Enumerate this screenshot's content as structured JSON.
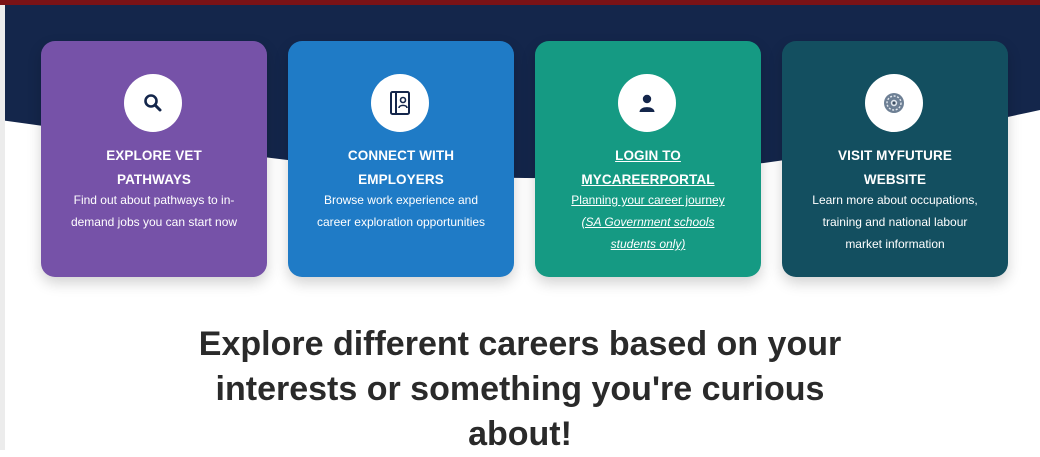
{
  "colors": {
    "top_bar": "#7a1216",
    "hero_navy": "#14264b",
    "card_purple": "#7652a8",
    "card_blue": "#1f7bc6",
    "card_teal": "#159a83",
    "card_dark_teal": "#134f60",
    "headline_text": "#2a2a2a"
  },
  "cards": [
    {
      "icon": "search-icon",
      "title_lines": [
        "EXPLORE VET",
        "PATHWAYS"
      ],
      "desc_lines": [
        "Find out about pathways to in-",
        "demand jobs you can start now"
      ]
    },
    {
      "icon": "contact-book-icon",
      "title_lines": [
        "CONNECT WITH",
        "EMPLOYERS"
      ],
      "desc_lines": [
        "Browse work experience and",
        "career exploration opportunities"
      ]
    },
    {
      "icon": "user-icon",
      "title_lines": [
        "LOGIN TO",
        "MYCAREERPORTAL"
      ],
      "desc_lines": [
        "Planning your career journey",
        "(SA Government schools",
        "students only)"
      ]
    },
    {
      "icon": "myfuture-badge-icon",
      "title_lines": [
        "VISIT MYFUTURE",
        "WEBSITE"
      ],
      "desc_lines": [
        "Learn more about occupations,",
        "training and national labour",
        "market information"
      ]
    }
  ],
  "headline_lines": [
    "Explore different careers based on your",
    "interests or something you're curious",
    "about!"
  ]
}
